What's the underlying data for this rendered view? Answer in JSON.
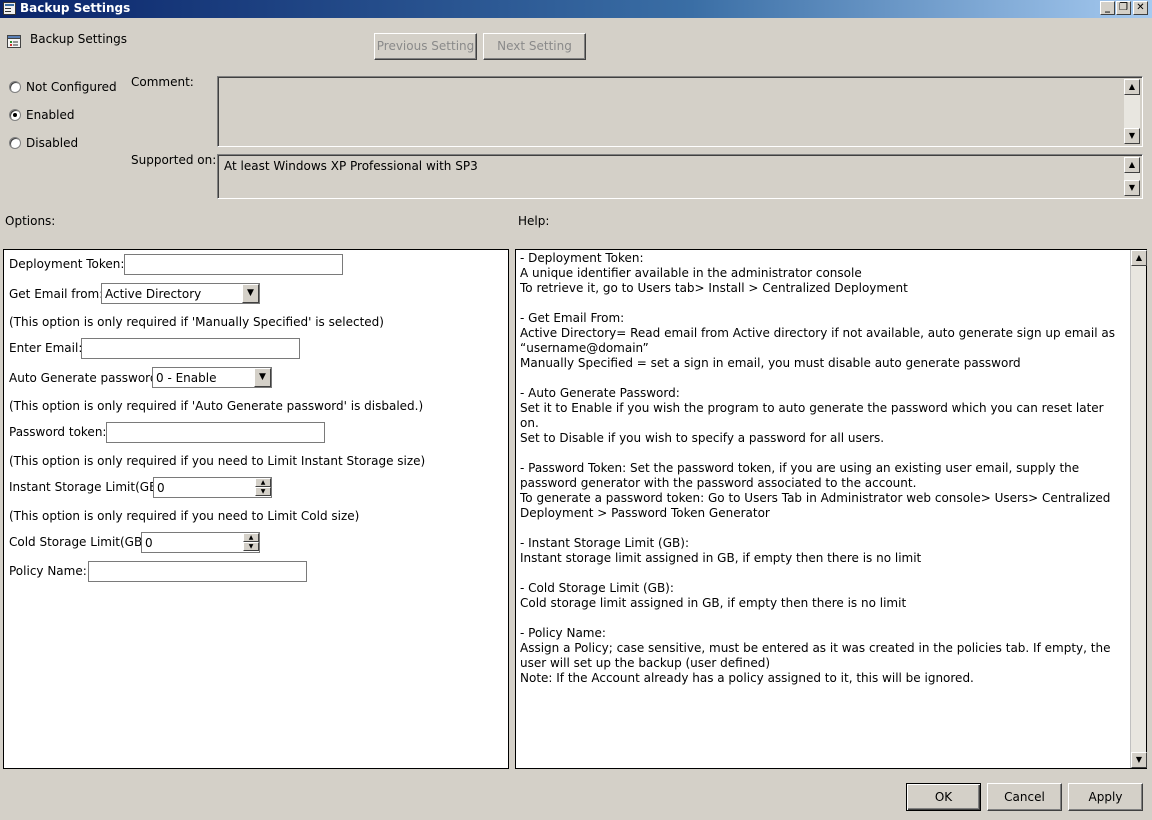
{
  "window": {
    "title": "Backup Settings",
    "header_label": "Backup Settings",
    "controls": {
      "minimize": "_",
      "restore": "❐",
      "close": "✕"
    }
  },
  "nav": {
    "previous_label": "Previous Setting",
    "next_label": "Next Setting"
  },
  "state": {
    "options": [
      {
        "label": "Not Configured",
        "selected": false
      },
      {
        "label": "Enabled",
        "selected": true
      },
      {
        "label": "Disabled",
        "selected": false
      }
    ]
  },
  "comment": {
    "label": "Comment:",
    "value": ""
  },
  "supported": {
    "label": "Supported on:",
    "value": "At least Windows XP Professional with SP3"
  },
  "sections": {
    "options_label": "Options:",
    "help_label": "Help:"
  },
  "options": {
    "deployment_token": {
      "label": "Deployment Token:",
      "value": ""
    },
    "get_email": {
      "label": "Get Email from:",
      "value": "Active Directory"
    },
    "note_manual": "(This option is only required if 'Manually Specified' is selected)",
    "enter_email": {
      "label": "Enter Email:",
      "value": ""
    },
    "auto_generate": {
      "label": "Auto Generate password",
      "value": "0 - Enable"
    },
    "note_autogen": "(This option is only required if 'Auto Generate password' is disbaled.)",
    "password_token": {
      "label": "Password token:",
      "value": ""
    },
    "note_instant": "(This option is only required if you need to Limit Instant Storage size)",
    "instant_limit": {
      "label": "Instant Storage Limit(GB)",
      "value": "0"
    },
    "note_cold": "(This option is only required if you need to Limit Cold size)",
    "cold_limit": {
      "label": "Cold Storage Limit(GB)",
      "value": "0"
    },
    "policy_name": {
      "label": "Policy Name:",
      "value": ""
    }
  },
  "help": {
    "paragraphs": [
      [
        "- Deployment Token:",
        "A unique identifier available in the administrator console",
        "To retrieve it, go to Users tab> Install > Centralized Deployment"
      ],
      [
        "- Get Email From:",
        "Active Directory= Read email from Active directory if not available, auto generate sign up email as “username@domain”",
        "Manually Specified = set a sign in email, you must disable auto generate password"
      ],
      [
        "- Auto Generate Password:",
        "Set it to Enable if you wish the program to auto generate the password which you can reset later on.",
        "Set to Disable if you wish to specify a password for all users."
      ],
      [
        "- Password Token: Set the password token, if you are using an existing user email, supply the password generator with the password associated to the account.",
        "To generate a password token: Go to Users Tab in Administrator web console> Users> Centralized Deployment > Password Token Generator"
      ],
      [
        "- Instant Storage Limit (GB):",
        "Instant storage limit assigned in GB, if empty then there is no limit"
      ],
      [
        "- Cold Storage Limit (GB):",
        "Cold storage limit assigned in GB, if empty then there is no limit"
      ],
      [
        "- Policy Name:",
        "Assign a Policy; case sensitive, must be entered as it was created in the policies tab. If empty, the user will set up the backup (user defined)",
        "Note: If the Account already has a policy assigned to it, this will be ignored."
      ]
    ]
  },
  "footer": {
    "ok_label": "OK",
    "cancel_label": "Cancel",
    "apply_label": "Apply"
  },
  "icons": {
    "window": "policy-settings-icon",
    "header": "policy-settings-icon",
    "scroll_up": "▲",
    "scroll_down": "▼",
    "dropdown": "▼"
  }
}
